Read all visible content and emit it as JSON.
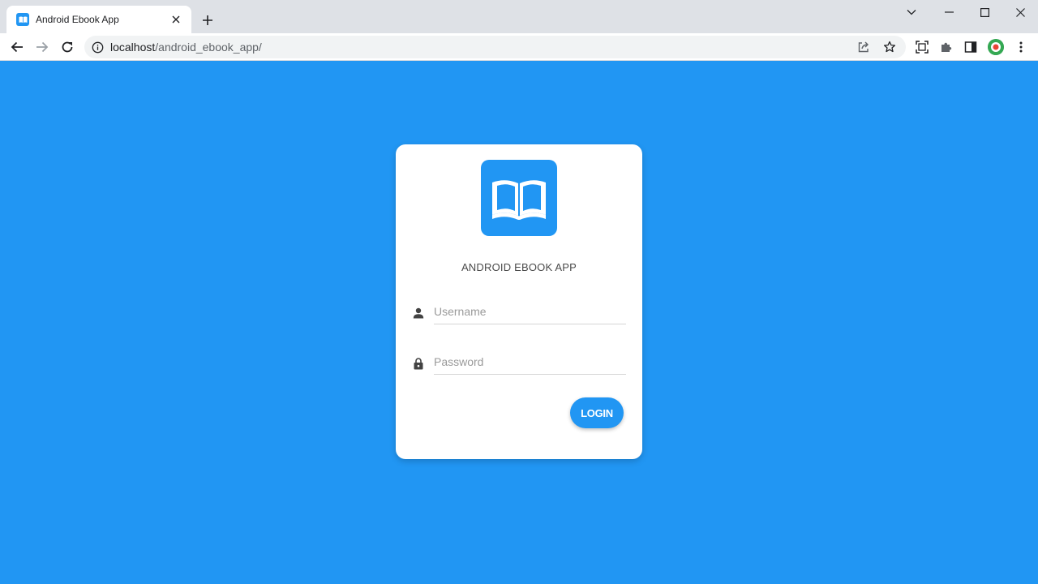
{
  "browser": {
    "tab_title": "Android Ebook App",
    "url_host": "localhost",
    "url_path": "/android_ebook_app/"
  },
  "app": {
    "title": "ANDROID EBOOK APP",
    "brand_color": "#2196f3",
    "logo_icon": "open-book-icon"
  },
  "form": {
    "username_placeholder": "Username",
    "username_icon": "user-icon",
    "password_placeholder": "Password",
    "password_icon": "lock-icon",
    "login_label": "LOGIN"
  }
}
